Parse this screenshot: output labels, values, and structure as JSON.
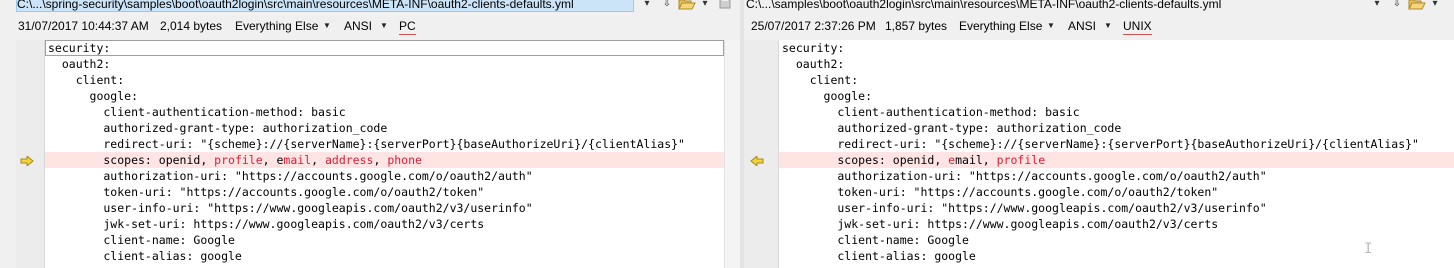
{
  "left": {
    "path": "C:\\...\\spring-security\\samples\\boot\\oauth2login\\src\\main\\resources\\META-INF\\oauth2-clients-defaults.yml",
    "timestamp": "31/07/2017 10:44:37 AM",
    "size": "2,014 bytes",
    "format": "Everything Else",
    "encoding": "ANSI",
    "line_endings": "PC",
    "lines": [
      "security:",
      "  oauth2:",
      "    client:",
      "      google:",
      "        client-authentication-method: basic",
      "        authorized-grant-type: authorization_code",
      "        redirect-uri: \"{scheme}://{serverName}:{serverPort}{baseAuthorizeUri}/{clientAlias}\"",
      "        scopes: openid, profile, email, address, phone",
      "        authorization-uri: \"https://accounts.google.com/o/oauth2/auth\"",
      "        token-uri: \"https://accounts.google.com/o/oauth2/token\"",
      "        user-info-uri: \"https://www.googleapis.com/oauth2/v3/userinfo\"",
      "        jwk-set-uri: https://www.googleapis.com/oauth2/v3/certs",
      "        client-name: Google",
      "        client-alias: google"
    ],
    "diff_line": {
      "prefix": "        scopes: openid, ",
      "seg1": "profile",
      "sep1": ", e",
      "seg2": "mail",
      "sep2": ", ",
      "seg3": "address",
      "sep3": ", ",
      "seg4": "phone"
    }
  },
  "right": {
    "path": "C:\\...\\samples\\boot\\oauth2login\\src\\main\\resources\\META-INF\\oauth2-clients-defaults.yml",
    "timestamp": "25/07/2017 2:37:26 PM",
    "size": "1,857 bytes",
    "format": "Everything Else",
    "encoding": "ANSI",
    "line_endings": "UNIX",
    "lines": [
      "security:",
      "  oauth2:",
      "    client:",
      "      google:",
      "        client-authentication-method: basic",
      "        authorized-grant-type: authorization_code",
      "        redirect-uri: \"{scheme}://{serverName}:{serverPort}{baseAuthorizeUri}/{clientAlias}\"",
      "        scopes: openid, email, profile",
      "        authorization-uri: \"https://accounts.google.com/o/oauth2/auth\"",
      "        token-uri: \"https://accounts.google.com/o/oauth2/token\"",
      "        user-info-uri: \"https://www.googleapis.com/oauth2/v3/userinfo\"",
      "        jwk-set-uri: https://www.googleapis.com/oauth2/v3/certs",
      "        client-name: Google",
      "        client-alias: google"
    ],
    "diff_line": {
      "prefix": "        scopes: openid, ",
      "seg1": "e",
      "mid": "mail, ",
      "seg2": "profile"
    }
  },
  "icons": {
    "nav": "down-arrow-icon",
    "folder": "folder-open-icon",
    "save": "save-icon",
    "diff_left": "diff-arrow-right-icon",
    "diff_right": "diff-arrow-left-icon"
  },
  "colors": {
    "diff_bg": "#ffe4e4",
    "diff_text": "#d4213b",
    "path_selected_bg": "#cce4f7"
  }
}
